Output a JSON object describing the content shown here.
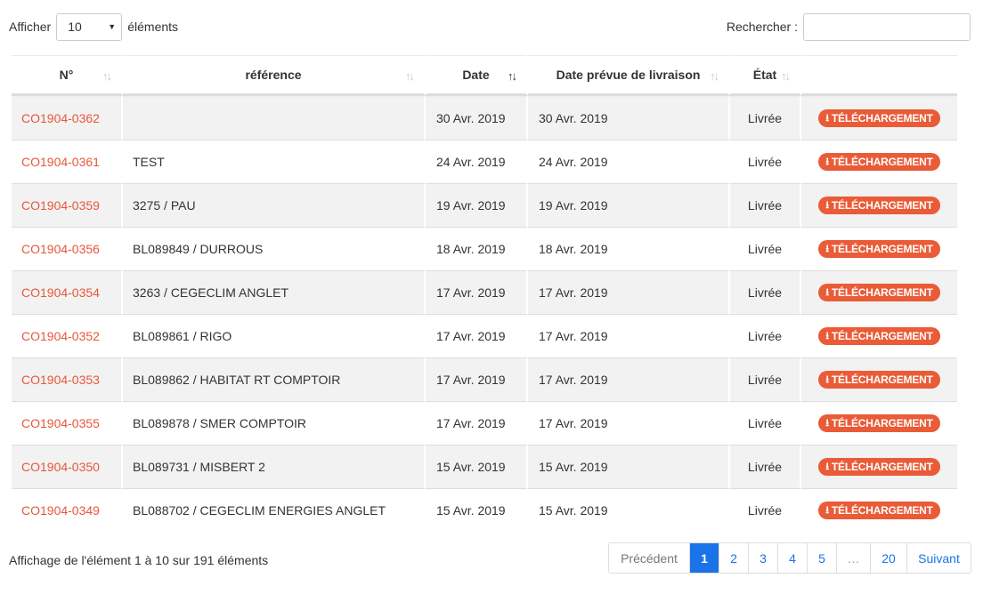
{
  "length_menu": {
    "before": "Afficher",
    "value": "10",
    "after": "éléments"
  },
  "search": {
    "label": "Rechercher :",
    "value": "",
    "placeholder": ""
  },
  "columns": [
    "N°",
    "référence",
    "Date",
    "Date prévue de livraison",
    "État",
    ""
  ],
  "rows": [
    {
      "num": "CO1904-0362",
      "ref": "",
      "date": "30 Avr. 2019",
      "livraison": "30 Avr. 2019",
      "etat": "Livrée",
      "action": "TÉLÉCHARGEMENT"
    },
    {
      "num": "CO1904-0361",
      "ref": "TEST",
      "date": "24 Avr. 2019",
      "livraison": "24 Avr. 2019",
      "etat": "Livrée",
      "action": "TÉLÉCHARGEMENT"
    },
    {
      "num": "CO1904-0359",
      "ref": "3275 / PAU",
      "date": "19 Avr. 2019",
      "livraison": "19 Avr. 2019",
      "etat": "Livrée",
      "action": "TÉLÉCHARGEMENT"
    },
    {
      "num": "CO1904-0356",
      "ref": "BL089849 / DURROUS",
      "date": "18 Avr. 2019",
      "livraison": "18 Avr. 2019",
      "etat": "Livrée",
      "action": "TÉLÉCHARGEMENT"
    },
    {
      "num": "CO1904-0354",
      "ref": "3263 / CEGECLIM ANGLET",
      "date": "17 Avr. 2019",
      "livraison": "17 Avr. 2019",
      "etat": "Livrée",
      "action": "TÉLÉCHARGEMENT"
    },
    {
      "num": "CO1904-0352",
      "ref": "BL089861 / RIGO",
      "date": "17 Avr. 2019",
      "livraison": "17 Avr. 2019",
      "etat": "Livrée",
      "action": "TÉLÉCHARGEMENT"
    },
    {
      "num": "CO1904-0353",
      "ref": "BL089862 / HABITAT RT COMPTOIR",
      "date": "17 Avr. 2019",
      "livraison": "17 Avr. 2019",
      "etat": "Livrée",
      "action": "TÉLÉCHARGEMENT"
    },
    {
      "num": "CO1904-0355",
      "ref": "BL089878 / SMER COMPTOIR",
      "date": "17 Avr. 2019",
      "livraison": "17 Avr. 2019",
      "etat": "Livrée",
      "action": "TÉLÉCHARGEMENT"
    },
    {
      "num": "CO1904-0350",
      "ref": "BL089731 / MISBERT 2",
      "date": "15 Avr. 2019",
      "livraison": "15 Avr. 2019",
      "etat": "Livrée",
      "action": "TÉLÉCHARGEMENT"
    },
    {
      "num": "CO1904-0349",
      "ref": "BL088702 / CEGECLIM ENERGIES ANGLET",
      "date": "15 Avr. 2019",
      "livraison": "15 Avr. 2019",
      "etat": "Livrée",
      "action": "TÉLÉCHARGEMENT"
    }
  ],
  "info": "Affichage de l'élément 1 à 10 sur 191 éléments",
  "pagination": {
    "prev": "Précédent",
    "pages": [
      "1",
      "2",
      "3",
      "4",
      "5",
      "…",
      "20"
    ],
    "next": "Suivant",
    "current": "1"
  },
  "colors": {
    "link": "#e8573c",
    "button": "#ea5b37",
    "active_page": "#1a73e8"
  },
  "icons": {
    "download": "download-icon",
    "sort": "sort-icon",
    "dropdown": "caret-down-icon"
  }
}
